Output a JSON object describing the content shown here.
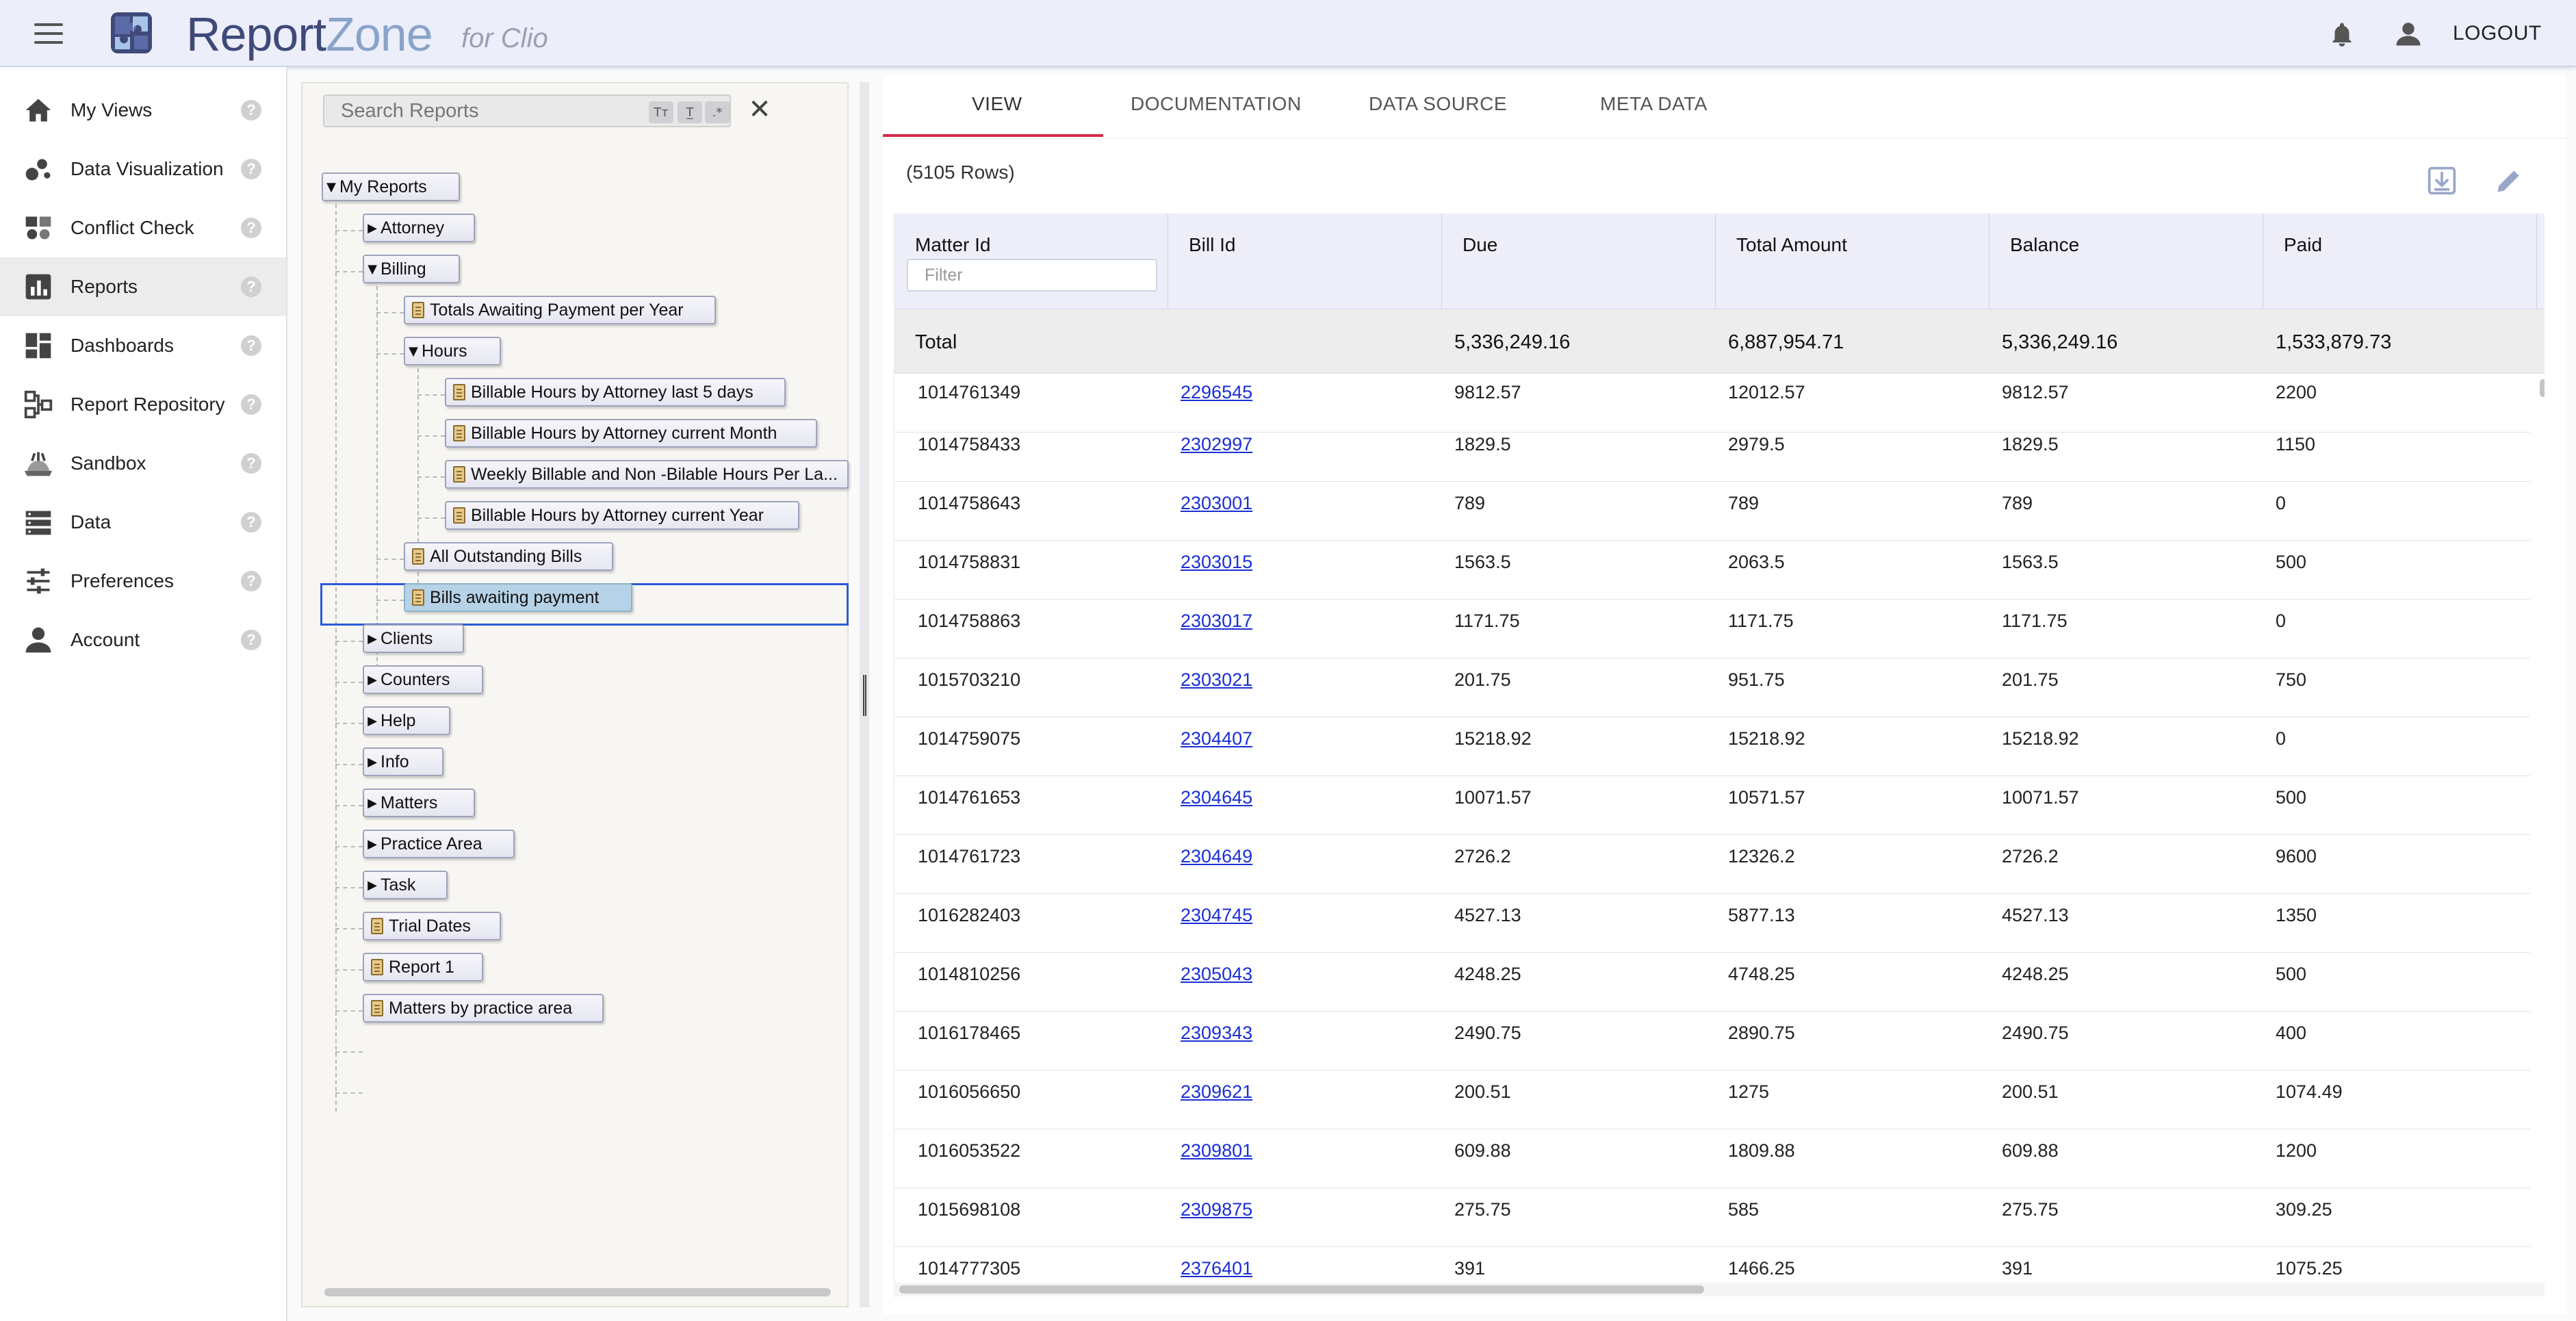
{
  "header": {
    "logo_report": "Report",
    "logo_zone": "Zone",
    "logo_sub": "for Clio",
    "logout_label": "LOGOUT"
  },
  "nav": {
    "items": [
      {
        "label": "My Views",
        "icon": "home-icon"
      },
      {
        "label": "Data Visualization",
        "icon": "scatter-icon"
      },
      {
        "label": "Conflict Check",
        "icon": "conflict-icon"
      },
      {
        "label": "Reports",
        "icon": "bar-chart-icon",
        "active": true
      },
      {
        "label": "Dashboards",
        "icon": "dashboard-icon"
      },
      {
        "label": "Report Repository",
        "icon": "repository-icon"
      },
      {
        "label": "Sandbox",
        "icon": "sandbox-icon"
      },
      {
        "label": "Data",
        "icon": "data-icon"
      },
      {
        "label": "Preferences",
        "icon": "sliders-icon"
      },
      {
        "label": "Account",
        "icon": "person-icon"
      }
    ],
    "help_glyph": "?"
  },
  "tree": {
    "search_placeholder": "Search Reports",
    "opt_case": "Tт",
    "opt_word": "T̲",
    "opt_regex": ".*",
    "clear": "✕",
    "root": "My Reports",
    "attorney": "Attorney",
    "billing": "Billing",
    "totals_awaiting": "Totals Awaiting Payment per Year",
    "hours": "Hours",
    "bh_last5": "Billable Hours by Attorney last 5 days",
    "bh_month": "Billable Hours by Attorney current Month",
    "weekly": "Weekly Billable and Non -Bilable Hours Per La...",
    "bh_year": "Billable Hours by Attorney current Year",
    "all_outstanding": "All Outstanding Bills",
    "bills_awaiting": "Bills awaiting payment",
    "clients": "Clients",
    "counters": "Counters",
    "help": "Help",
    "info": "Info",
    "matters": "Matters",
    "practice_area": "Practice Area",
    "task": "Task",
    "trial_dates": "Trial Dates",
    "report1": "Report 1",
    "matters_by_pa": "Matters by practice area"
  },
  "tabs": [
    "VIEW",
    "DOCUMENTATION",
    "DATA SOURCE",
    "META DATA"
  ],
  "rowcount": "(5105 Rows)",
  "grid": {
    "columns": [
      "Matter Id",
      "Bill Id",
      "Due",
      "Total Amount",
      "Balance",
      "Paid"
    ],
    "filter_placeholder": "Filter",
    "total": {
      "label": "Total",
      "due": "5,336,249.16",
      "total_amount": "6,887,954.71",
      "balance": "5,336,249.16",
      "paid": "1,533,879.73"
    },
    "rows": [
      [
        "1014761349",
        "2296545",
        "9812.57",
        "12012.57",
        "9812.57",
        "2200"
      ],
      [
        "1014758433",
        "2302997",
        "1829.5",
        "2979.5",
        "1829.5",
        "1150"
      ],
      [
        "1014758643",
        "2303001",
        "789",
        "789",
        "789",
        "0"
      ],
      [
        "1014758831",
        "2303015",
        "1563.5",
        "2063.5",
        "1563.5",
        "500"
      ],
      [
        "1014758863",
        "2303017",
        "1171.75",
        "1171.75",
        "1171.75",
        "0"
      ],
      [
        "1015703210",
        "2303021",
        "201.75",
        "951.75",
        "201.75",
        "750"
      ],
      [
        "1014759075",
        "2304407",
        "15218.92",
        "15218.92",
        "15218.92",
        "0"
      ],
      [
        "1014761653",
        "2304645",
        "10071.57",
        "10571.57",
        "10071.57",
        "500"
      ],
      [
        "1014761723",
        "2304649",
        "2726.2",
        "12326.2",
        "2726.2",
        "9600"
      ],
      [
        "1016282403",
        "2304745",
        "4527.13",
        "5877.13",
        "4527.13",
        "1350"
      ],
      [
        "1014810256",
        "2305043",
        "4248.25",
        "4748.25",
        "4248.25",
        "500"
      ],
      [
        "1016178465",
        "2309343",
        "2490.75",
        "2890.75",
        "2490.75",
        "400"
      ],
      [
        "1016056650",
        "2309621",
        "200.51",
        "1275",
        "200.51",
        "1074.49"
      ],
      [
        "1016053522",
        "2309801",
        "609.88",
        "1809.88",
        "609.88",
        "1200"
      ],
      [
        "1015698108",
        "2309875",
        "275.75",
        "585",
        "275.75",
        "309.25"
      ],
      [
        "1014777305",
        "2376401",
        "391",
        "1466.25",
        "391",
        "1075.25"
      ]
    ]
  }
}
